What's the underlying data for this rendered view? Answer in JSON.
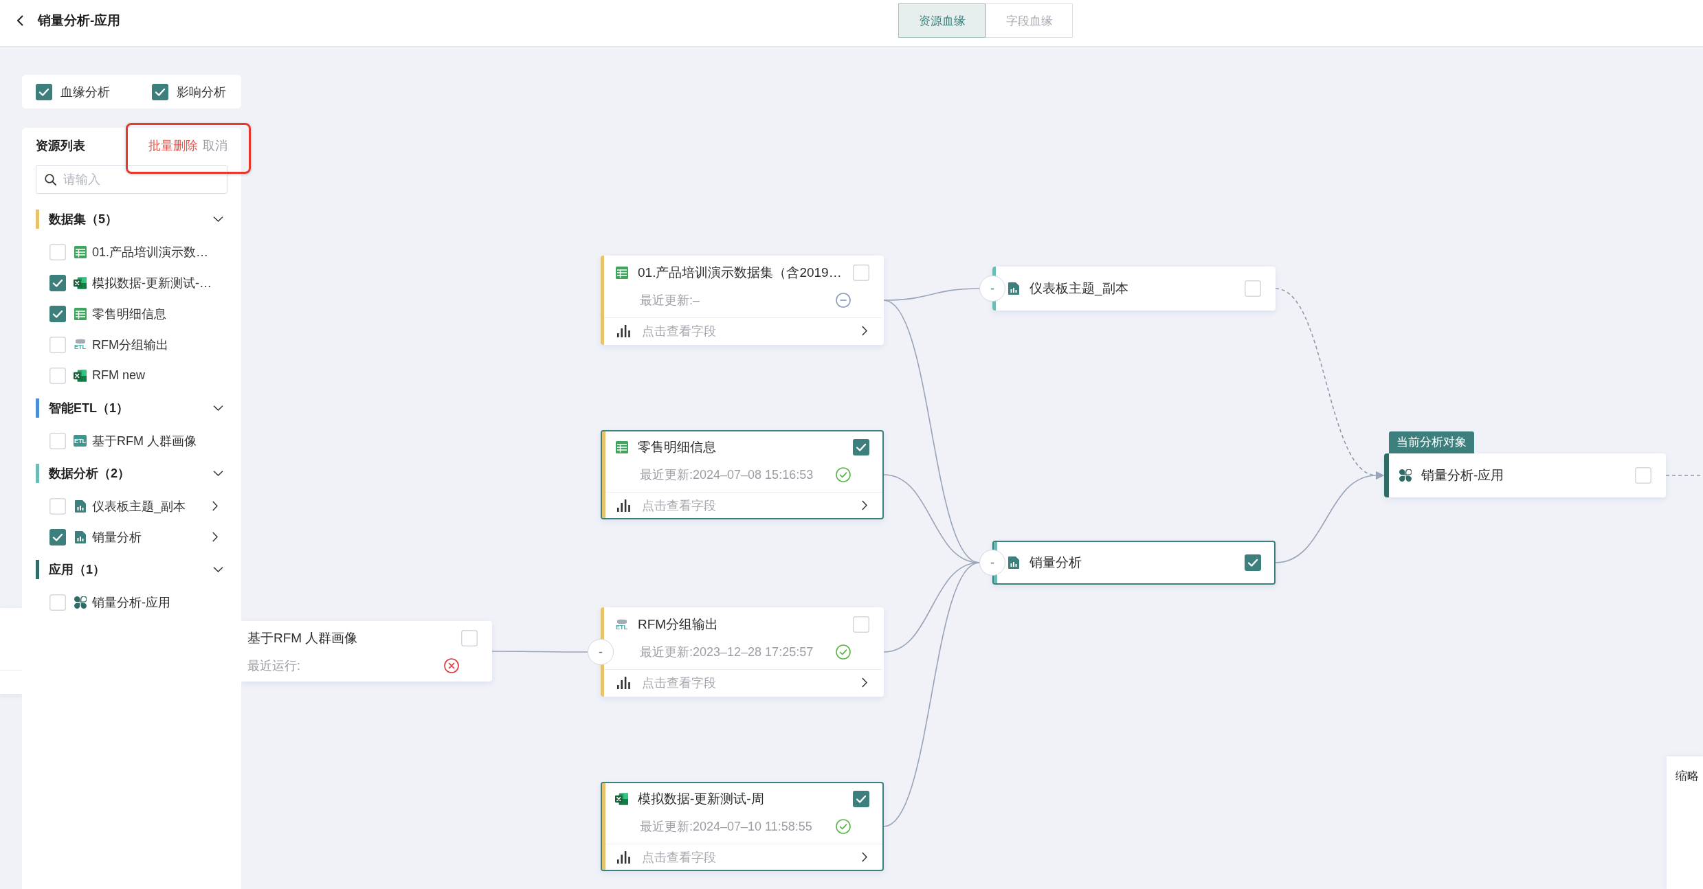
{
  "header": {
    "title": "销量分析-应用",
    "tabs": [
      {
        "label": "资源血缘",
        "selected": true
      },
      {
        "label": "字段血缘",
        "selected": false
      }
    ]
  },
  "analysis_options": [
    {
      "label": "血缘分析",
      "checked": true
    },
    {
      "label": "影响分析",
      "checked": true
    }
  ],
  "resource_list": {
    "title": "资源列表",
    "actions": [
      {
        "label": "批量删除",
        "kind": "danger"
      },
      {
        "label": "取消",
        "kind": "plain"
      }
    ],
    "actions_highlighted": true,
    "search": {
      "placeholder": "请输入"
    },
    "groups": [
      {
        "label": "数据集（5）",
        "color": "#e6c26a",
        "expanded": true,
        "items": [
          {
            "label": "01.产品培训演示数…",
            "kind": "dataset",
            "checked": false,
            "expandable": false
          },
          {
            "label": "模拟数据-更新测试-…",
            "kind": "excel",
            "checked": true,
            "expandable": false
          },
          {
            "label": "零售明细信息",
            "kind": "dataset",
            "checked": true,
            "expandable": false
          },
          {
            "label": "RFM分组输出",
            "kind": "etl_output",
            "badge": "ETL",
            "checked": false,
            "expandable": false
          },
          {
            "label": "RFM new",
            "kind": "excel",
            "checked": false,
            "expandable": false
          }
        ]
      },
      {
        "label": "智能ETL（1）",
        "color": "#4a8fd6",
        "expanded": true,
        "items": [
          {
            "label": "基于RFM 人群画像",
            "kind": "etl",
            "badge": "ETL",
            "checked": false,
            "expandable": false
          }
        ]
      },
      {
        "label": "数据分析（2）",
        "color": "#6dbcb6",
        "expanded": true,
        "items": [
          {
            "label": "仪表板主题_副本",
            "kind": "dashboard",
            "checked": false,
            "expandable": true
          },
          {
            "label": "销量分析",
            "kind": "dashboard",
            "checked": true,
            "expandable": true
          }
        ]
      },
      {
        "label": "应用（1）",
        "color": "#2e6b66",
        "expanded": true,
        "items": [
          {
            "label": "销量分析-应用",
            "kind": "app",
            "checked": false,
            "expandable": false
          }
        ]
      }
    ]
  },
  "canvas": {
    "nodes": [
      {
        "title": "基于RFM 人群画像",
        "meta": "最近运行:",
        "status": {
          "kind": "error"
        },
        "checked": false,
        "selected": false
      },
      {
        "kind": "dataset",
        "color": "#e6c26a",
        "title": "01.产品培训演示数据集（含2019…",
        "meta": "最近更新:–",
        "status": {
          "kind": "none"
        },
        "checked": false,
        "selected": false,
        "footer": "点击查看字段"
      },
      {
        "kind": "dataset",
        "color": "#e6c26a",
        "title": "零售明细信息",
        "meta": "最近更新:2024–07–08 15:16:53",
        "status": {
          "kind": "ok"
        },
        "checked": true,
        "selected": true,
        "footer": "点击查看字段"
      },
      {
        "kind": "etl_output",
        "badge": "ETL",
        "color": "#e6c26a",
        "toggle": "-",
        "title": "RFM分组输出",
        "meta": "最近更新:2023–12–28 17:25:57",
        "status": {
          "kind": "ok"
        },
        "checked": false,
        "selected": false,
        "footer": "点击查看字段"
      },
      {
        "kind": "excel",
        "color": "#e6c26a",
        "title": "模拟数据-更新测试-周",
        "meta": "最近更新:2024–07–10 11:58:55",
        "status": {
          "kind": "ok"
        },
        "checked": true,
        "selected": true,
        "footer": "点击查看字段"
      },
      {
        "kind": "dashboard",
        "color": "#6dbcb6",
        "toggle": "-",
        "title": "仪表板主题_副本",
        "checked": false,
        "selected": false
      },
      {
        "kind": "dashboard",
        "color": "#6dbcb6",
        "toggle": "-",
        "title": "销量分析",
        "checked": true,
        "selected": true
      },
      {
        "kind": "app",
        "color": "#2e6b66",
        "tag": "当前分析对象",
        "title": "销量分析-应用",
        "checked": false,
        "selected": false
      }
    ],
    "edges": [
      {
        "kind": "solid",
        "arrow": false
      },
      {
        "kind": "solid",
        "arrow": false
      },
      {
        "kind": "solid",
        "arrow": false
      },
      {
        "kind": "solid",
        "arrow": false
      },
      {
        "kind": "solid",
        "arrow": false
      },
      {
        "kind": "solid",
        "arrow": false
      },
      {
        "kind": "dashed",
        "arrow": true
      },
      {
        "kind": "solid",
        "arrow": true
      },
      {
        "kind": "dashed",
        "arrow": false
      }
    ]
  },
  "minimap": {
    "label": "缩略"
  }
}
